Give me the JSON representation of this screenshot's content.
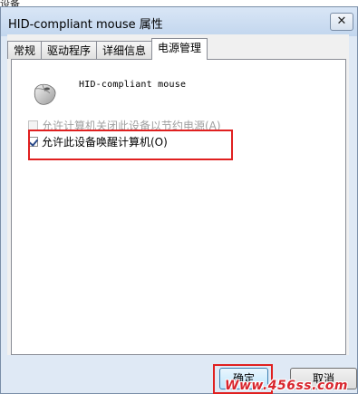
{
  "outer_title": "设备",
  "window": {
    "title": "HID-compliant mouse 属性",
    "close_label": "✕"
  },
  "tabs": [
    {
      "label": "常规",
      "active": false
    },
    {
      "label": "驱动程序",
      "active": false
    },
    {
      "label": "详细信息",
      "active": false
    },
    {
      "label": "电源管理",
      "active": true
    }
  ],
  "device": {
    "name": "HID-compliant mouse",
    "icon": "mouse-icon"
  },
  "options": [
    {
      "label": "允许计算机关闭此设备以节约电源(A)",
      "checked": false,
      "enabled": false
    },
    {
      "label": "允许此设备唤醒计算机(O)",
      "checked": true,
      "enabled": true
    }
  ],
  "buttons": {
    "ok": "确定",
    "cancel": "取消"
  },
  "watermark": "Www.456ss.com",
  "colors": {
    "highlight": "#e02020",
    "watermark": "#d8262e"
  }
}
